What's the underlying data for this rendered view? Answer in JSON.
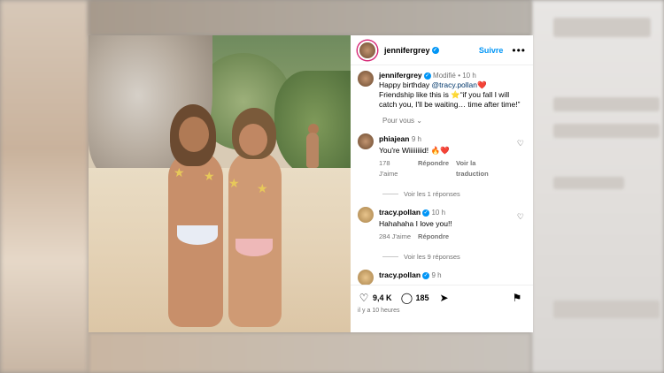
{
  "post": {
    "username": "jennifergrey",
    "follow_label": "Suivre",
    "more_label": "•••",
    "caption": {
      "username": "jennifergrey",
      "modified": "Modifié",
      "time": "10 h",
      "line1": "Happy birthday ",
      "mention": "@tracy.pollan",
      "heart": "❤️",
      "line2": "Friendship like this is ⭐️“if you fall I will catch you, I'll be waiting… time after time!”"
    },
    "for_you_label": "Pour vous ⌄",
    "comments": [
      {
        "username": "phiajean",
        "time": "9 h",
        "text": "You're Wiiiiiiiid! 🔥❤️",
        "likes": "178 J'aime",
        "reply": "Répondre",
        "translate": "Voir la traduction",
        "replies": "Voir les 1 réponses"
      },
      {
        "username": "tracy.pollan",
        "time": "10 h",
        "text": "Hahahaha I love you!!",
        "likes": "284 J'aime",
        "reply": "Répondre",
        "replies": "Voir les 9 réponses"
      },
      {
        "username": "tracy.pollan",
        "time": "9 h"
      }
    ],
    "likes_count": "9,4 K",
    "comments_count": "185",
    "posted_ago": "il y a 10 heures"
  },
  "colors": {
    "accent": "#0095f6",
    "ring": "#d62976"
  },
  "icons": [
    "heart-icon",
    "comment-icon",
    "share-icon",
    "bookmark-icon",
    "verified-icon"
  ]
}
